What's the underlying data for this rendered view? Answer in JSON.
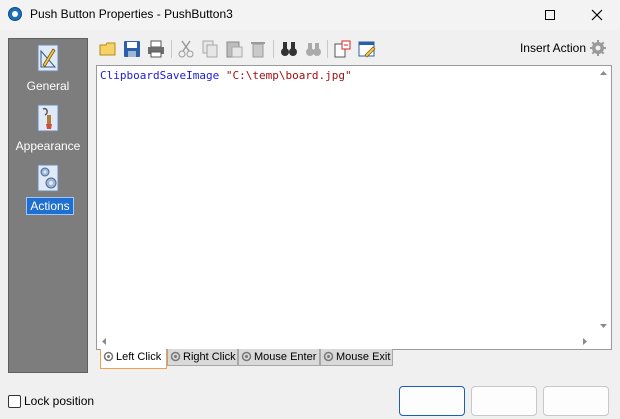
{
  "window": {
    "title": "Push Button Properties - PushButton3"
  },
  "sidebar": {
    "items": [
      {
        "label": "General",
        "icon": "pencil-ruler-icon",
        "selected": false
      },
      {
        "label": "Appearance",
        "icon": "paintbrush-icon",
        "selected": false
      },
      {
        "label": "Actions",
        "icon": "gears-icon",
        "selected": true
      }
    ]
  },
  "toolbar": {
    "buttons": [
      "open-folder-icon",
      "save-icon",
      "print-icon",
      "cut-icon",
      "copy-icon",
      "paste-icon",
      "delete-icon",
      "find-icon",
      "replace-icon",
      "insert-icon",
      "edit-icon"
    ],
    "insert_action_label": "Insert Action"
  },
  "editor": {
    "code_keyword": "ClipboardSaveImage",
    "code_string": "\"C:\\temp\\board.jpg\""
  },
  "tabs": [
    {
      "label": "Left Click",
      "active": true
    },
    {
      "label": "Right Click",
      "active": false
    },
    {
      "label": "Mouse Enter",
      "active": false
    },
    {
      "label": "Mouse Exit",
      "active": false
    }
  ],
  "footer": {
    "lock_label": "Lock position",
    "lock_checked": false
  },
  "colors": {
    "sidebar_bg": "#7d7d7d",
    "selected_bg": "#1f6fd1",
    "tab_active_border": "#f0a04a"
  }
}
